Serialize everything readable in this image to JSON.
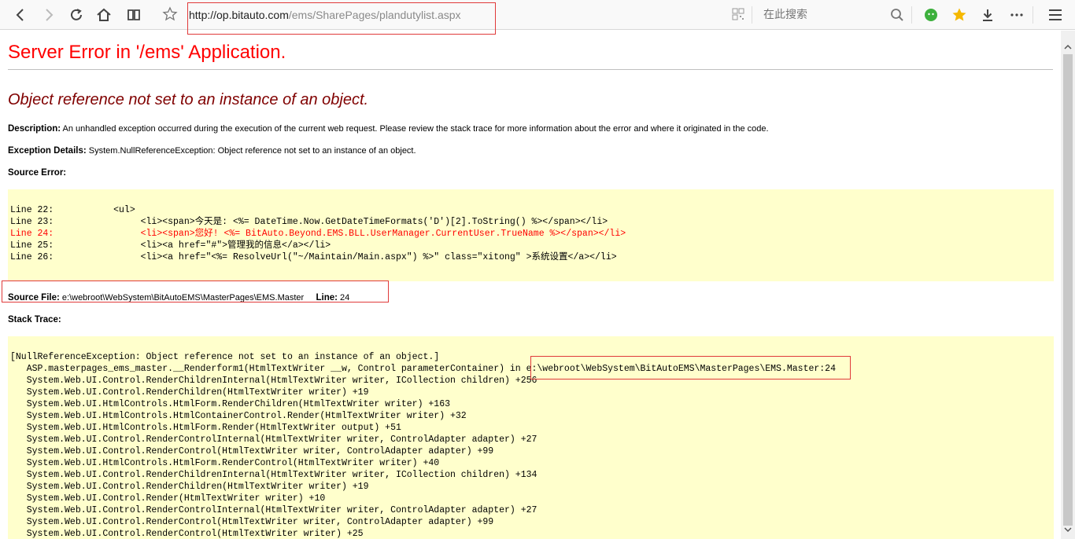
{
  "browser": {
    "url_host": "http://op.bitauto.com",
    "url_path": "/ems/SharePages/plandutylist.aspx",
    "search_placeholder": "在此搜索",
    "icons": [
      "back-icon",
      "forward-icon",
      "reload-icon",
      "home-icon",
      "reader-icon",
      "star-icon",
      "qr-icon",
      "search-icon",
      "wechat-icon",
      "favorites-icon",
      "download-icon",
      "more-icon",
      "menu-icon"
    ]
  },
  "page": {
    "title": "Server Error in '/ems' Application.",
    "subtitle": "Object reference not set to an instance of an object.",
    "description_label": "Description:",
    "description_text": "An unhandled exception occurred during the execution of the current web request. Please review the stack trace for more information about the error and where it originated in the code.",
    "exception_label": "Exception Details:",
    "exception_text": "System.NullReferenceException: Object reference not set to an instance of an object.",
    "source_error_label": "Source Error:",
    "source_lines": [
      {
        "text": "Line 22:           <ul>",
        "error": false
      },
      {
        "text": "Line 23:                <li><span>今天是: <%= DateTime.Now.GetDateTimeFormats('D')[2].ToString() %></span></li>",
        "error": false
      },
      {
        "text": "Line 24:                <li><span>您好! <%= BitAuto.Beyond.EMS.BLL.UserManager.CurrentUser.TrueName %></span></li>",
        "error": true
      },
      {
        "text": "Line 25:                <li><a href=\"#\">管理我的信息</a></li>",
        "error": false
      },
      {
        "text": "Line 26:                <li><a href=\"<%= ResolveUrl(\"~/Maintain/Main.aspx\") %>\" class=\"xitong\" >系统设置</a></li>",
        "error": false
      }
    ],
    "source_file_label": "Source File:",
    "source_file_value": "e:\\webroot\\WebSystem\\BitAutoEMS\\MasterPages\\EMS.Master",
    "line_label": "Line:",
    "line_value": "24",
    "stack_trace_label": "Stack Trace:",
    "stack_lines": [
      "[NullReferenceException: Object reference not set to an instance of an object.]",
      "   ASP.masterpages_ems_master.__Renderform1(HtmlTextWriter __w, Control parameterContainer) in e:\\webroot\\WebSystem\\BitAutoEMS\\MasterPages\\EMS.Master:24",
      "   System.Web.UI.Control.RenderChildrenInternal(HtmlTextWriter writer, ICollection children) +256",
      "   System.Web.UI.Control.RenderChildren(HtmlTextWriter writer) +19",
      "   System.Web.UI.HtmlControls.HtmlForm.RenderChildren(HtmlTextWriter writer) +163",
      "   System.Web.UI.HtmlControls.HtmlContainerControl.Render(HtmlTextWriter writer) +32",
      "   System.Web.UI.HtmlControls.HtmlForm.Render(HtmlTextWriter output) +51",
      "   System.Web.UI.Control.RenderControlInternal(HtmlTextWriter writer, ControlAdapter adapter) +27",
      "   System.Web.UI.Control.RenderControl(HtmlTextWriter writer, ControlAdapter adapter) +99",
      "   System.Web.UI.HtmlControls.HtmlForm.RenderControl(HtmlTextWriter writer) +40",
      "   System.Web.UI.Control.RenderChildrenInternal(HtmlTextWriter writer, ICollection children) +134",
      "   System.Web.UI.Control.RenderChildren(HtmlTextWriter writer) +19",
      "   System.Web.UI.Control.Render(HtmlTextWriter writer) +10",
      "   System.Web.UI.Control.RenderControlInternal(HtmlTextWriter writer, ControlAdapter adapter) +27",
      "   System.Web.UI.Control.RenderControl(HtmlTextWriter writer, ControlAdapter adapter) +99",
      "   System.Web.UI.Control.RenderControl(HtmlTextWriter writer) +25"
    ]
  },
  "colors": {
    "title": "#ff0000",
    "subtitle": "#800000",
    "code_bg": "#ffffcc",
    "annotation_box": "#e03a3a",
    "star": "#f5b800",
    "wechat": "#3db03d"
  }
}
